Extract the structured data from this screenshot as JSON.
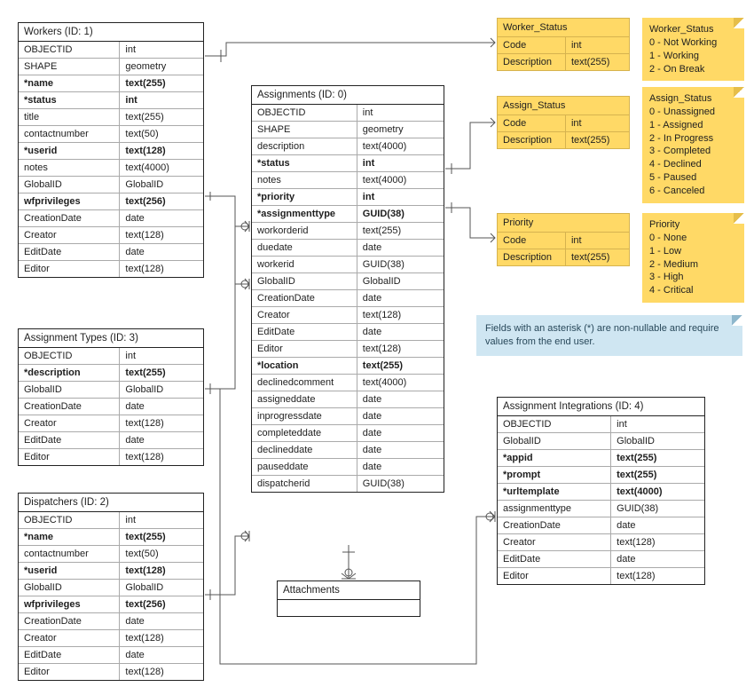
{
  "entities": {
    "workers": {
      "title": "Workers (ID: 1)",
      "rows": [
        {
          "name": "OBJECTID",
          "type": "int",
          "bold": false
        },
        {
          "name": "SHAPE",
          "type": "geometry",
          "bold": false
        },
        {
          "name": "*name",
          "type": "text(255)",
          "bold": true
        },
        {
          "name": "*status",
          "type": "int",
          "bold": true
        },
        {
          "name": "title",
          "type": "text(255)",
          "bold": false
        },
        {
          "name": "contactnumber",
          "type": "text(50)",
          "bold": false
        },
        {
          "name": "*userid",
          "type": "text(128)",
          "bold": true
        },
        {
          "name": "notes",
          "type": "text(4000)",
          "bold": false
        },
        {
          "name": "GlobalID",
          "type": "GlobalID",
          "bold": false
        },
        {
          "name": "wfprivileges",
          "type": "text(256)",
          "bold": true
        },
        {
          "name": "CreationDate",
          "type": "date",
          "bold": false
        },
        {
          "name": "Creator",
          "type": "text(128)",
          "bold": false
        },
        {
          "name": "EditDate",
          "type": "date",
          "bold": false
        },
        {
          "name": "Editor",
          "type": "text(128)",
          "bold": false
        }
      ]
    },
    "assignments": {
      "title": "Assignments (ID: 0)",
      "rows": [
        {
          "name": "OBJECTID",
          "type": "int",
          "bold": false
        },
        {
          "name": "SHAPE",
          "type": "geometry",
          "bold": false
        },
        {
          "name": "description",
          "type": "text(4000)",
          "bold": false
        },
        {
          "name": "*status",
          "type": "int",
          "bold": true
        },
        {
          "name": "notes",
          "type": "text(4000)",
          "bold": false
        },
        {
          "name": "*priority",
          "type": "int",
          "bold": true
        },
        {
          "name": "*assignmenttype",
          "type": "GUID(38)",
          "bold": true
        },
        {
          "name": "workorderid",
          "type": "text(255)",
          "bold": false
        },
        {
          "name": "duedate",
          "type": "date",
          "bold": false
        },
        {
          "name": "workerid",
          "type": "GUID(38)",
          "bold": false
        },
        {
          "name": "GlobalID",
          "type": "GlobalID",
          "bold": false
        },
        {
          "name": "CreationDate",
          "type": "date",
          "bold": false
        },
        {
          "name": "Creator",
          "type": "text(128)",
          "bold": false
        },
        {
          "name": "EditDate",
          "type": "date",
          "bold": false
        },
        {
          "name": "Editor",
          "type": "text(128)",
          "bold": false
        },
        {
          "name": "*location",
          "type": "text(255)",
          "bold": true
        },
        {
          "name": "declinedcomment",
          "type": "text(4000)",
          "bold": false
        },
        {
          "name": "assigneddate",
          "type": "date",
          "bold": false
        },
        {
          "name": "inprogressdate",
          "type": "date",
          "bold": false
        },
        {
          "name": "completeddate",
          "type": "date",
          "bold": false
        },
        {
          "name": "declineddate",
          "type": "date",
          "bold": false
        },
        {
          "name": "pauseddate",
          "type": "date",
          "bold": false
        },
        {
          "name": "dispatcherid",
          "type": "GUID(38)",
          "bold": false
        }
      ]
    },
    "assignment_types": {
      "title": "Assignment Types (ID: 3)",
      "rows": [
        {
          "name": "OBJECTID",
          "type": "int",
          "bold": false
        },
        {
          "name": "*description",
          "type": "text(255)",
          "bold": true
        },
        {
          "name": "GlobalID",
          "type": "GlobalID",
          "bold": false
        },
        {
          "name": "CreationDate",
          "type": "date",
          "bold": false
        },
        {
          "name": "Creator",
          "type": "text(128)",
          "bold": false
        },
        {
          "name": "EditDate",
          "type": "date",
          "bold": false
        },
        {
          "name": "Editor",
          "type": "text(128)",
          "bold": false
        }
      ]
    },
    "dispatchers": {
      "title": "Dispatchers (ID: 2)",
      "rows": [
        {
          "name": "OBJECTID",
          "type": "int",
          "bold": false
        },
        {
          "name": "*name",
          "type": "text(255)",
          "bold": true
        },
        {
          "name": "contactnumber",
          "type": "text(50)",
          "bold": false
        },
        {
          "name": "*userid",
          "type": "text(128)",
          "bold": true
        },
        {
          "name": "GlobalID",
          "type": "GlobalID",
          "bold": false
        },
        {
          "name": "wfprivileges",
          "type": "text(256)",
          "bold": true
        },
        {
          "name": "CreationDate",
          "type": "date",
          "bold": false
        },
        {
          "name": "Creator",
          "type": "text(128)",
          "bold": false
        },
        {
          "name": "EditDate",
          "type": "date",
          "bold": false
        },
        {
          "name": "Editor",
          "type": "text(128)",
          "bold": false
        }
      ]
    },
    "integrations": {
      "title": "Assignment Integrations (ID: 4)",
      "rows": [
        {
          "name": "OBJECTID",
          "type": "int",
          "bold": false
        },
        {
          "name": "GlobalID",
          "type": "GlobalID",
          "bold": false
        },
        {
          "name": "*appid",
          "type": "text(255)",
          "bold": true
        },
        {
          "name": "*prompt",
          "type": "text(255)",
          "bold": true
        },
        {
          "name": "*urltemplate",
          "type": "text(4000)",
          "bold": true
        },
        {
          "name": "assignmenttype",
          "type": "GUID(38)",
          "bold": false
        },
        {
          "name": "CreationDate",
          "type": "date",
          "bold": false
        },
        {
          "name": "Creator",
          "type": "text(128)",
          "bold": false
        },
        {
          "name": "EditDate",
          "type": "date",
          "bold": false
        },
        {
          "name": "Editor",
          "type": "text(128)",
          "bold": false
        }
      ]
    },
    "attachments": {
      "title": "Attachments"
    }
  },
  "lookups": {
    "worker_status": {
      "title": "Worker_Status",
      "rows": [
        {
          "a": "Code",
          "b": "int"
        },
        {
          "a": "Description",
          "b": "text(255)"
        }
      ]
    },
    "assign_status": {
      "title": "Assign_Status",
      "rows": [
        {
          "a": "Code",
          "b": "int"
        },
        {
          "a": "Description",
          "b": "text(255)"
        }
      ]
    },
    "priority": {
      "title": "Priority",
      "rows": [
        {
          "a": "Code",
          "b": "int"
        },
        {
          "a": "Description",
          "b": "text(255)"
        }
      ]
    }
  },
  "notes": {
    "worker_status": "Worker_Status\n0 - Not Working\n1 - Working\n2 - On Break",
    "assign_status": "Assign_Status\n0 - Unassigned\n1 - Assigned\n2 - In Progress\n3 - Completed\n4 - Declined\n5 - Paused\n6 - Canceled",
    "priority": "Priority\n0 - None\n1 - Low\n2 - Medium\n3 - High\n4 - Critical",
    "info": "Fields with an asterisk (*) are non-nullable and require values from the end user."
  }
}
